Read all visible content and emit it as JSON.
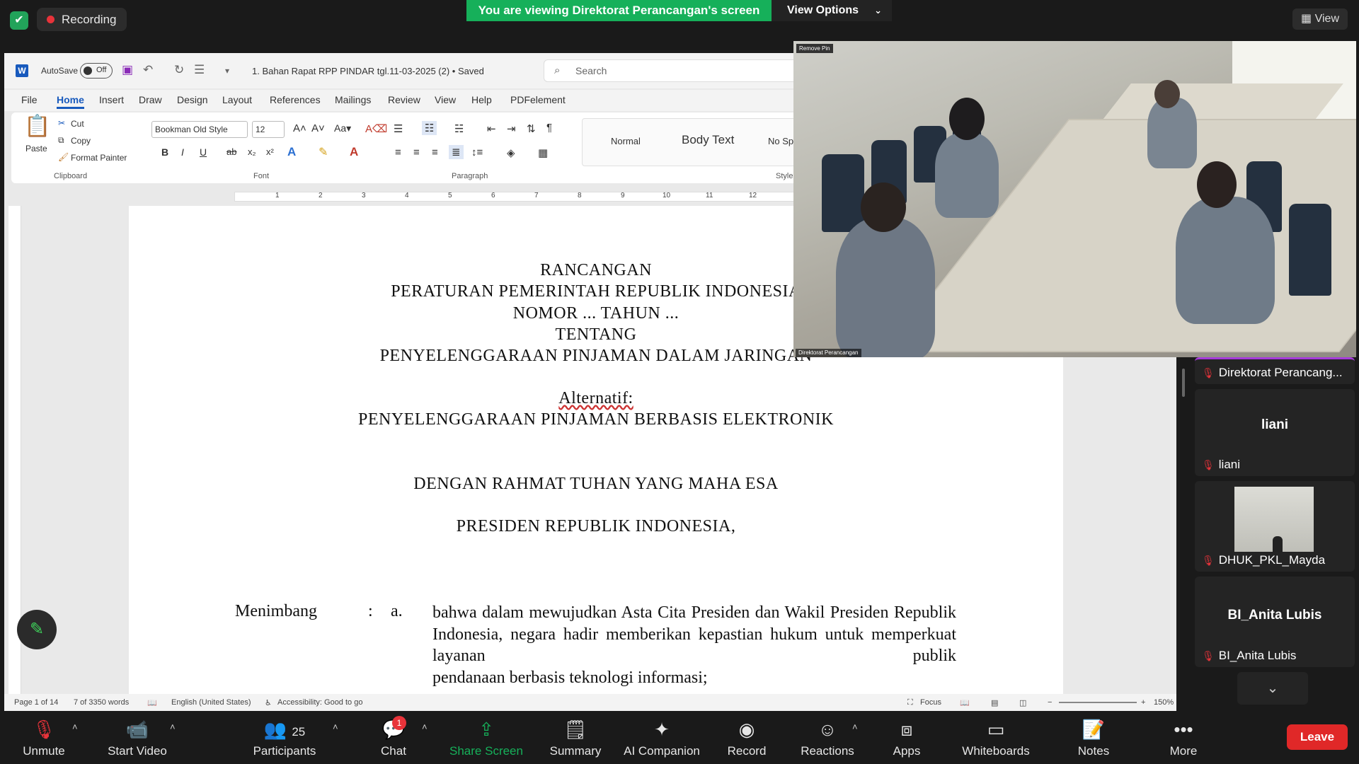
{
  "topbar": {
    "recording": "Recording",
    "viewing": "You are viewing Direktorat Perancangan's screen",
    "view_options": "View Options",
    "view": "View"
  },
  "word": {
    "autosave": "AutoSave",
    "autosave_state": "Off",
    "doc_title": "1. Bahan Rapat RPP PINDAR tgl.11-03-2025 (2) • Saved",
    "search_placeholder": "Search",
    "tabs": [
      "File",
      "Home",
      "Insert",
      "Draw",
      "Design",
      "Layout",
      "References",
      "Mailings",
      "Review",
      "View",
      "Help",
      "PDFelement"
    ],
    "active_tab": "Home",
    "clipboard": {
      "paste": "Paste",
      "cut": "Cut",
      "copy": "Copy",
      "format_painter": "Format Painter",
      "label": "Clipboard"
    },
    "font": {
      "family": "Bookman Old Style",
      "size": "12",
      "label": "Font"
    },
    "paragraph_label": "Paragraph",
    "styles": {
      "normal": "Normal",
      "body_text": "Body Text",
      "no_spacing": "No Spaci",
      "label": "Styles"
    },
    "ruler_ticks": [
      "1",
      "2",
      "3",
      "4",
      "5",
      "6",
      "7",
      "8",
      "9",
      "10",
      "11",
      "12"
    ],
    "document": {
      "line1": "RANCANGAN",
      "line2": "PERATURAN PEMERINTAH REPUBLIK INDONESIA",
      "line3": "NOMOR ... TAHUN ...",
      "line4": "TENTANG",
      "line5": "PENYELENGGARAAN PINJAMAN DALAM JARINGAN",
      "line6": "Alternatif:",
      "line7": "PENYELENGGARAAN PINJAMAN BERBASIS ELEKTRONIK",
      "line8": "DENGAN RAHMAT TUHAN YANG MAHA ESA",
      "line9": "PRESIDEN REPUBLIK INDONESIA,",
      "menimbang": "Menimbang",
      "colon": ":",
      "item": "a.",
      "body": "bahwa dalam mewujudkan Asta Cita Presiden dan Wakil Presiden Republik Indonesia, negara hadir memberikan kepastian hukum untuk memperkuat layanan publik",
      "body_last": "pendanaan berbasis teknologi informasi;"
    },
    "status": {
      "page": "Page 1 of 14",
      "words": "7 of 3350 words",
      "language": "English (United States)",
      "accessibility": "Accessibility: Good to go",
      "focus": "Focus",
      "zoom": "150%"
    }
  },
  "video": {
    "remove_pin": "Remove Pin",
    "name": "Direktorat Perancangan"
  },
  "participants": [
    {
      "name": "Direktorat Perancang..."
    },
    {
      "name": "liani",
      "display": "liani"
    },
    {
      "name": "DHUK_PKL_Mayda"
    },
    {
      "name": "BI_Anita Lubis",
      "display": "BI_Anita Lubis"
    }
  ],
  "toolbar": {
    "unmute": "Unmute",
    "start_video": "Start Video",
    "participants": "Participants",
    "participants_count": "25",
    "chat": "Chat",
    "chat_badge": "1",
    "share_screen": "Share Screen",
    "summary": "Summary",
    "ai_companion": "AI Companion",
    "record": "Record",
    "reactions": "Reactions",
    "apps": "Apps",
    "whiteboards": "Whiteboards",
    "notes": "Notes",
    "more": "More",
    "leave": "Leave"
  },
  "colors": {
    "accent_green": "#16b05a",
    "leave_red": "#e02828",
    "word_blue": "#185abd"
  }
}
